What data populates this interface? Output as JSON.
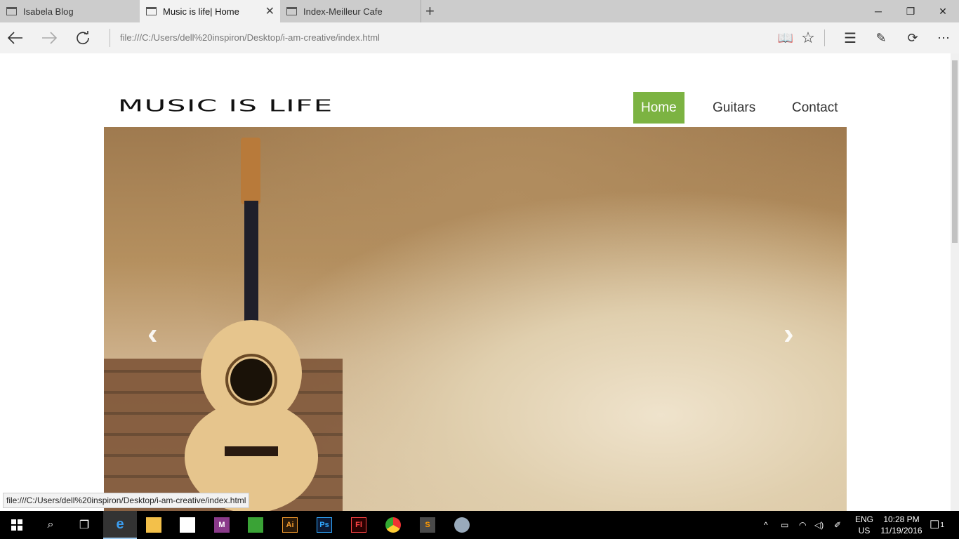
{
  "tabs": [
    {
      "title": "Isabela Blog"
    },
    {
      "title": "Music is life| Home"
    },
    {
      "title": "Index-Meilleur Cafe"
    }
  ],
  "address": {
    "url": "file:///C:/Users/dell%20inspiron/Desktop/i-am-creative/index.html"
  },
  "site": {
    "logo": "MUSIC IS LIFE",
    "nav": [
      "Home",
      "Guitars",
      "Contact"
    ],
    "active_color": "#7cb342"
  },
  "status_url": "file:///C:/Users/dell%20inspiron/Desktop/i-am-creative/index.html",
  "tray": {
    "lang": "ENG",
    "region": "US",
    "time": "10:28 PM",
    "date": "11/19/2016",
    "notif_count": "1"
  },
  "taskbar_labels": {
    "illustrator": "Ai",
    "photoshop": "Ps",
    "flash": "Fl",
    "sublime": "S",
    "malwarebytes": "M"
  }
}
